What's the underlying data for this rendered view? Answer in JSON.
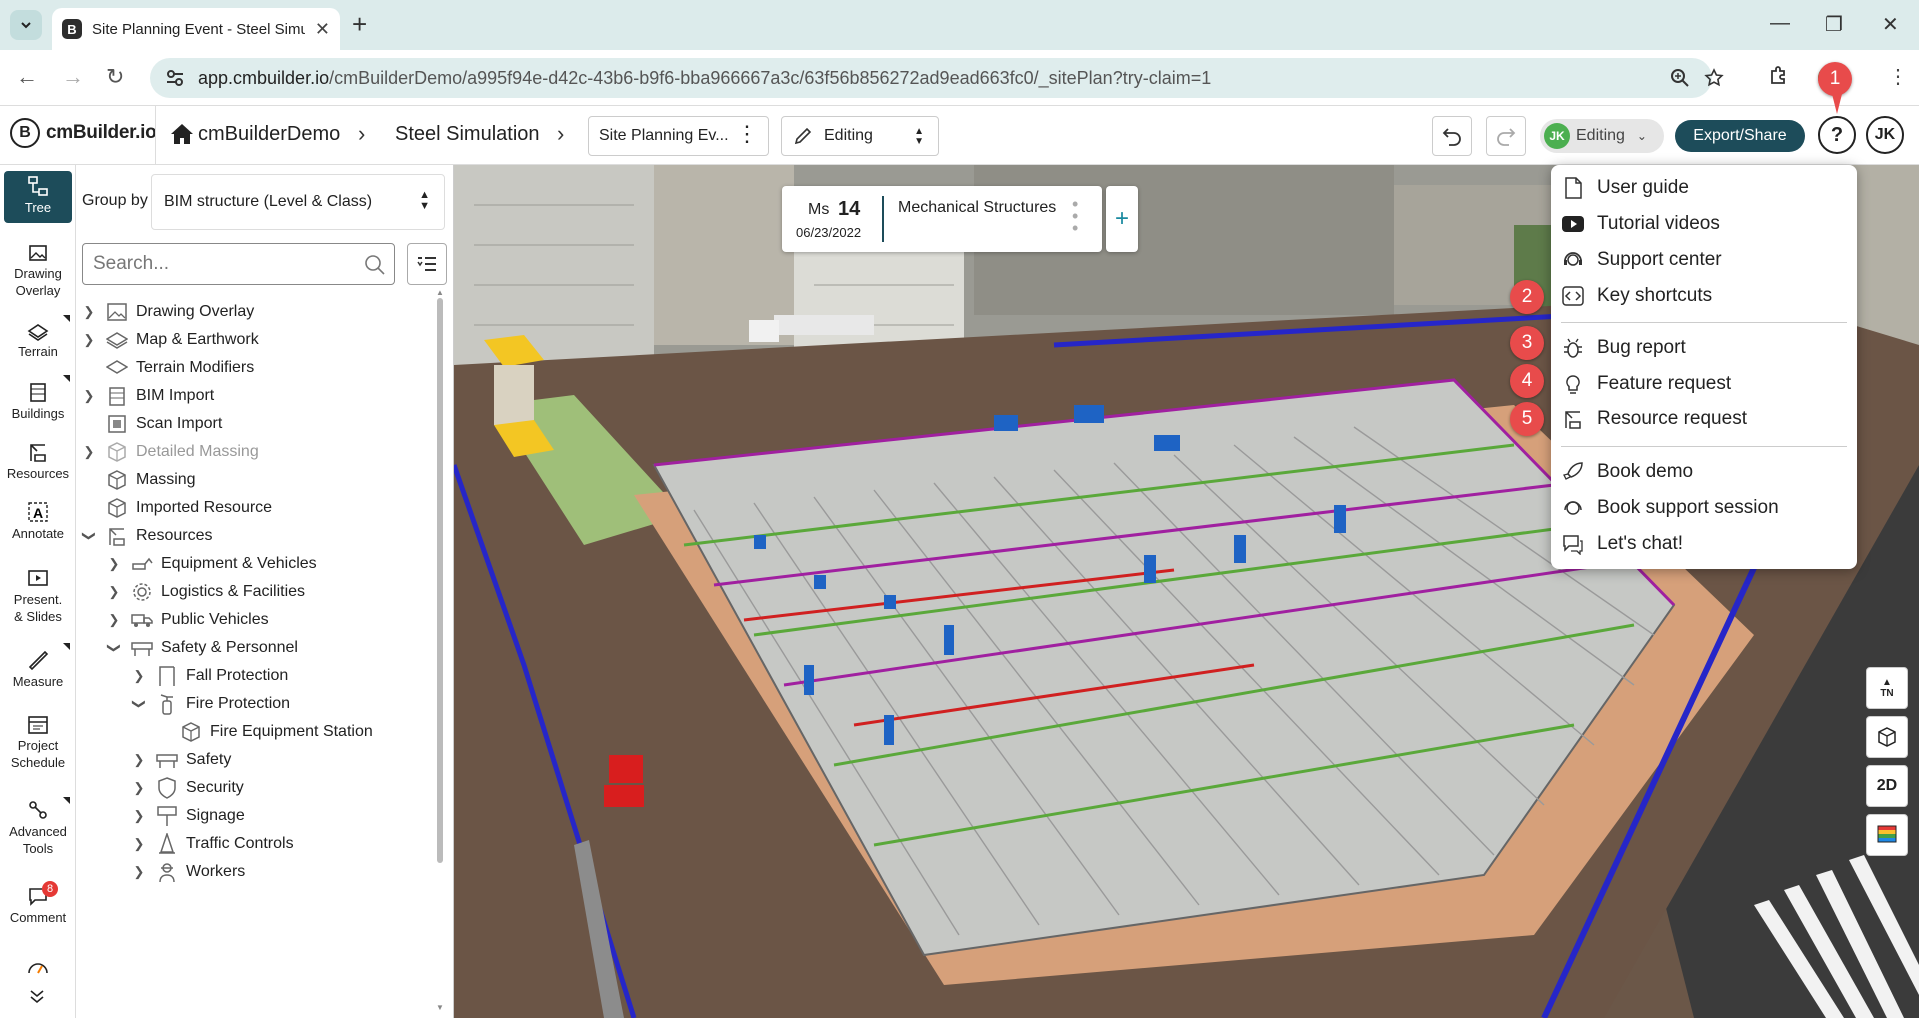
{
  "browser": {
    "tab_title": "Site Planning Event - Steel Simu",
    "url_host": "app.cmbuilder.io",
    "url_path": "/cmBuilderDemo/a995f94e-d42c-43b6-b9f6-bba966667a3c/63f56b856272ad9ead663fc0/_sitePlan?try-claim=1"
  },
  "header": {
    "logo_text": "cmBuilder.io",
    "logo_mark": "B",
    "crumb_home": "cmBuilderDemo",
    "crumb_project": "Steel Simulation",
    "event_select": "Site Planning Ev...",
    "mode_select": "Editing",
    "presence_initials": "JK",
    "presence_label": "Editing",
    "export_label": "Export/Share",
    "help_label": "?",
    "user_initials": "JK"
  },
  "rail": {
    "tree": "Tree",
    "drawing_overlay": "Drawing Overlay",
    "terrain": "Terrain",
    "buildings": "Buildings",
    "resources": "Resources",
    "annotate": "Annotate",
    "present": "Present. & Slides",
    "measure": "Measure",
    "project_schedule": "Project Schedule",
    "advanced_tools": "Advanced Tools",
    "comment": "Comment",
    "comment_badge": "8"
  },
  "panel": {
    "groupby_label": "Group by",
    "groupby_value": "BIM structure (Level & Class)",
    "search_placeholder": "Search...",
    "tree": [
      "Drawing Overlay",
      "Map & Earthwork",
      "Terrain Modifiers",
      "BIM Import",
      "Scan Import",
      "Detailed Massing",
      "Massing",
      "Imported Resource",
      "Resources",
      "Equipment & Vehicles",
      "Logistics & Facilities",
      "Public Vehicles",
      "Safety & Personnel",
      "Fall Protection",
      "Fire Protection",
      "Fire Equipment Station",
      "Safety",
      "Security",
      "Signage",
      "Traffic Controls",
      "Workers"
    ]
  },
  "milestone": {
    "prefix": "Ms",
    "number": "14",
    "date": "06/23/2022",
    "title": "Mechanical Structures"
  },
  "viewport_tools": {
    "north": "TN",
    "view2d": "2D"
  },
  "help_menu": {
    "items": [
      "User guide",
      "Tutorial videos",
      "Support center",
      "Key shortcuts",
      "Bug report",
      "Feature request",
      "Resource request",
      "Book demo",
      "Book support session",
      "Let's chat!"
    ]
  },
  "callouts": [
    "1",
    "2",
    "3",
    "4",
    "5"
  ],
  "colors": {
    "brand_dark": "#1d4c5a",
    "callout_red": "#e84b4b",
    "browser_chrome": "#dcebeb"
  }
}
